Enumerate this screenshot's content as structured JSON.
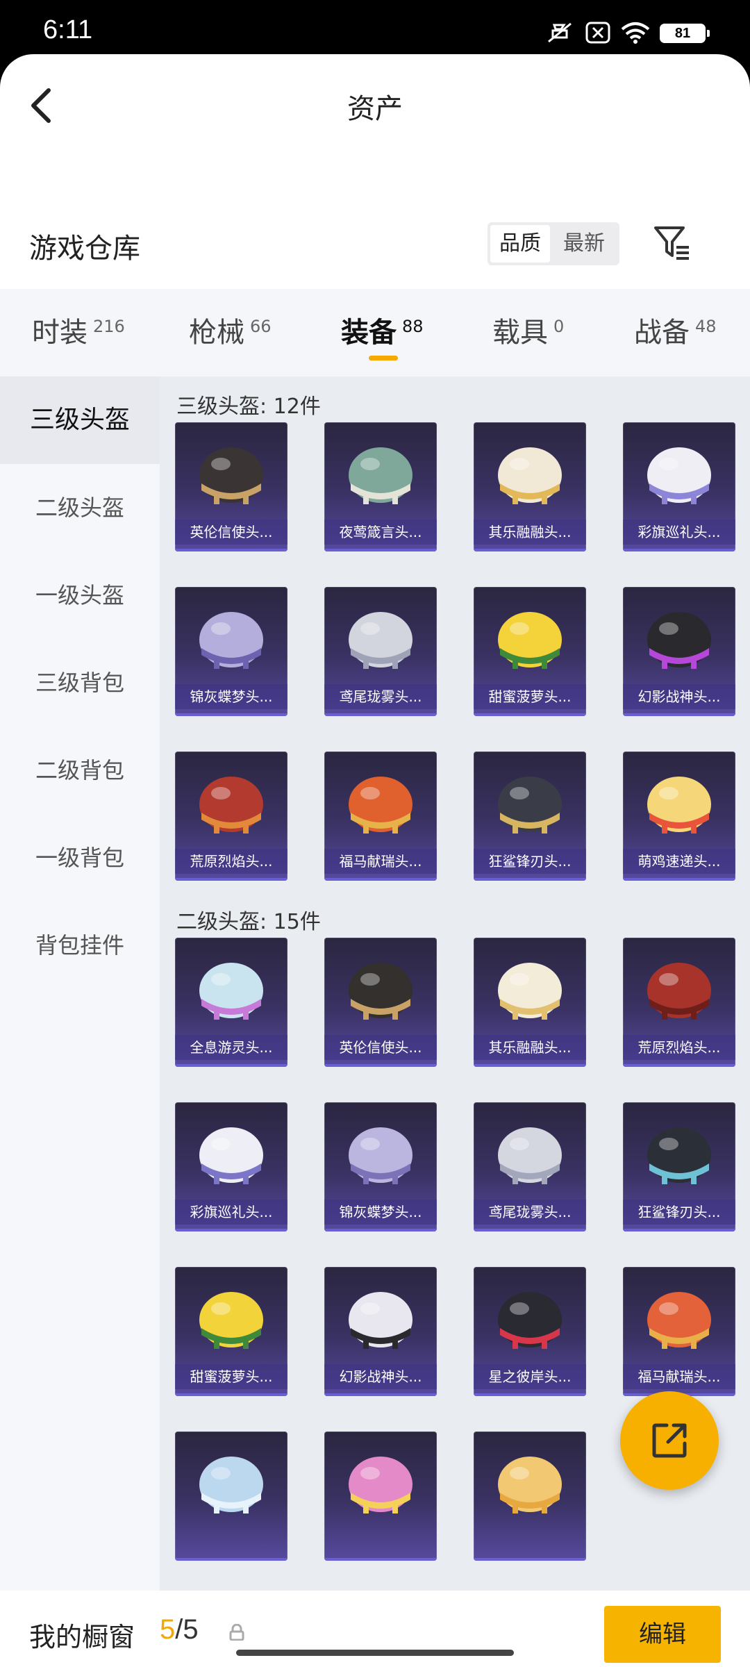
{
  "status_bar": {
    "time": "6:11",
    "battery": "81"
  },
  "header": {
    "title": "资产"
  },
  "section": {
    "title": "游戏仓库",
    "sort_quality": "品质",
    "sort_newest": "最新"
  },
  "tabs": [
    {
      "label": "时装",
      "count": "216"
    },
    {
      "label": "枪械",
      "count": "66"
    },
    {
      "label": "装备",
      "count": "88",
      "active": true
    },
    {
      "label": "载具",
      "count": "0"
    },
    {
      "label": "战备",
      "count": "48"
    }
  ],
  "sidebar": {
    "items": [
      {
        "label": "三级头盔",
        "active": true
      },
      {
        "label": "二级头盔"
      },
      {
        "label": "一级头盔"
      },
      {
        "label": "三级背包"
      },
      {
        "label": "二级背包"
      },
      {
        "label": "一级背包"
      },
      {
        "label": "背包挂件"
      }
    ]
  },
  "groups": [
    {
      "title": "三级头盔: 12件",
      "items": [
        {
          "name": "英伦信使头...",
          "color": "#3a3434",
          "accent": "#c9a268"
        },
        {
          "name": "夜莺箴言头...",
          "color": "#7fa89a",
          "accent": "#e3e3d8"
        },
        {
          "name": "其乐融融头...",
          "color": "#f1e9d6",
          "accent": "#e2b858"
        },
        {
          "name": "彩旗巡礼头...",
          "color": "#eeeef4",
          "accent": "#8d86d8"
        },
        {
          "name": "锦灰蝶梦头...",
          "color": "#b3aedb",
          "accent": "#6c62b0"
        },
        {
          "name": "鸢尾珑雾头...",
          "color": "#d2d4de",
          "accent": "#9ea3b8"
        },
        {
          "name": "甜蜜菠萝头...",
          "color": "#f3d23a",
          "accent": "#3e8a3a"
        },
        {
          "name": "幻影战神头...",
          "color": "#2a2a2e",
          "accent": "#b548d8"
        },
        {
          "name": "荒原烈焰头...",
          "color": "#b23a2e",
          "accent": "#e28a3a"
        },
        {
          "name": "福马献瑞头...",
          "color": "#e0602e",
          "accent": "#e8b24a"
        },
        {
          "name": "狂鲨锋刃头...",
          "color": "#3a3d48",
          "accent": "#d8b560"
        },
        {
          "name": "萌鸡速递头...",
          "color": "#f5d77a",
          "accent": "#e8553a"
        }
      ]
    },
    {
      "title": "二级头盔: 15件",
      "items": [
        {
          "name": "全息游灵头...",
          "color": "#c9e4ef",
          "accent": "#c87ad8"
        },
        {
          "name": "英伦信使头...",
          "color": "#33302e",
          "accent": "#c9a268"
        },
        {
          "name": "其乐融融头...",
          "color": "#f3ecd8",
          "accent": "#e2c070"
        },
        {
          "name": "荒原烈焰头...",
          "color": "#a8332b",
          "accent": "#6e1f1a"
        },
        {
          "name": "彩旗巡礼头...",
          "color": "#eeeef6",
          "accent": "#7b76c8"
        },
        {
          "name": "锦灰蝶梦头...",
          "color": "#bbb6df",
          "accent": "#7b72b8"
        },
        {
          "name": "鸢尾珑雾头...",
          "color": "#d4d6e0",
          "accent": "#a2a7bb"
        },
        {
          "name": "狂鲨锋刃头...",
          "color": "#2b2f38",
          "accent": "#6fc1d6"
        },
        {
          "name": "甜蜜菠萝头...",
          "color": "#f2d33a",
          "accent": "#3e8a3a"
        },
        {
          "name": "幻影战神头...",
          "color": "#e8e6ee",
          "accent": "#2a2a2e"
        },
        {
          "name": "星之彼岸头...",
          "color": "#2a2a33",
          "accent": "#d8364a"
        },
        {
          "name": "福马献瑞头...",
          "color": "#e3623a",
          "accent": "#e9b04a"
        },
        {
          "name": "",
          "color": "#bcd8ef",
          "accent": "#e8f2fa"
        },
        {
          "name": "",
          "color": "#e58ac8",
          "accent": "#f4d25a"
        },
        {
          "name": "",
          "color": "#f2c872",
          "accent": "#e8a840"
        }
      ]
    }
  ],
  "bottom_bar": {
    "label": "我的橱窗",
    "current": "5",
    "total": "/5",
    "edit_label": "编辑"
  }
}
